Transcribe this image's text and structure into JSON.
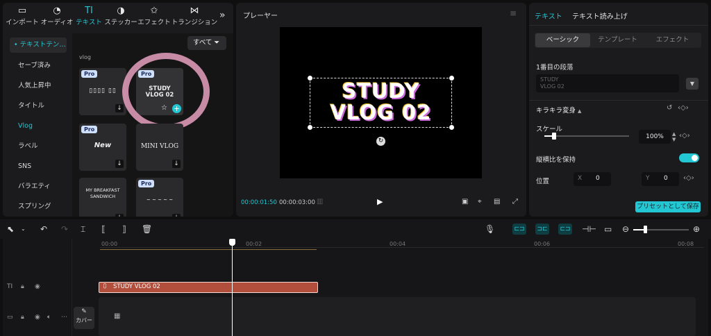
{
  "top_tabs": [
    {
      "label": "インポート",
      "icon": "import-icon"
    },
    {
      "label": "オーディオ",
      "icon": "audio-icon"
    },
    {
      "label": "テキスト",
      "icon": "text-icon"
    },
    {
      "label": "ステッカー",
      "icon": "sticker-icon"
    },
    {
      "label": "エフェクト",
      "icon": "effect-icon"
    },
    {
      "label": "トランジション",
      "icon": "transition-icon"
    }
  ],
  "categories": [
    "• テキストテン…",
    "セーブ済み",
    "人気上昇中",
    "タイトル",
    "Vlog",
    "ラベル",
    "SNS",
    "バラエティ",
    "スプリング"
  ],
  "grid": {
    "filter_label": "すべて",
    "top_label": "vlog",
    "cards": [
      {
        "pro": "Pro",
        "text": "▯▯▯▯ ▯▯"
      },
      {
        "pro": "Pro",
        "text": "STUDY\nVLOG 02"
      },
      {
        "pro": "Pro",
        "text": "New"
      },
      {
        "pro": "",
        "text": "MINI VLOG"
      },
      {
        "pro": "",
        "text": "MY BREAKFAST\nSANDWICH"
      },
      {
        "pro": "Pro",
        "text": "~ ~ ~ ~ ~"
      }
    ]
  },
  "player": {
    "title": "プレーヤー",
    "overlay_line1": "STUDY",
    "overlay_line2": "VLOG 02",
    "current_time": "00:00:01:50",
    "total_time": "00:00:03:00"
  },
  "right": {
    "tab_text": "テキスト",
    "tab_tts": "テキスト読み上げ",
    "seg_basic": "ベーシック",
    "seg_template": "テンプレート",
    "seg_effect": "エフェクト",
    "paragraph_label": "1番目の段落",
    "paragraph_value": "STUDY\nVLOG 02",
    "sparkle_label": "キラキラ変身",
    "scale_label": "スケール",
    "scale_value": "100%",
    "aspect_label": "縦横比を保持",
    "position_label": "位置",
    "x_label": "X",
    "x_value": "0",
    "y_label": "Y",
    "y_value": "0",
    "save_preset": "プリセットとして保存"
  },
  "timeline": {
    "ticks": [
      "00:00",
      "00:02",
      "00:04",
      "00:06",
      "00:08"
    ],
    "clip_label": "STUDY VLOG 02",
    "cover_label": "カバー"
  },
  "colors": {
    "accent": "#22c7d3",
    "clip": "#b14e3c"
  }
}
